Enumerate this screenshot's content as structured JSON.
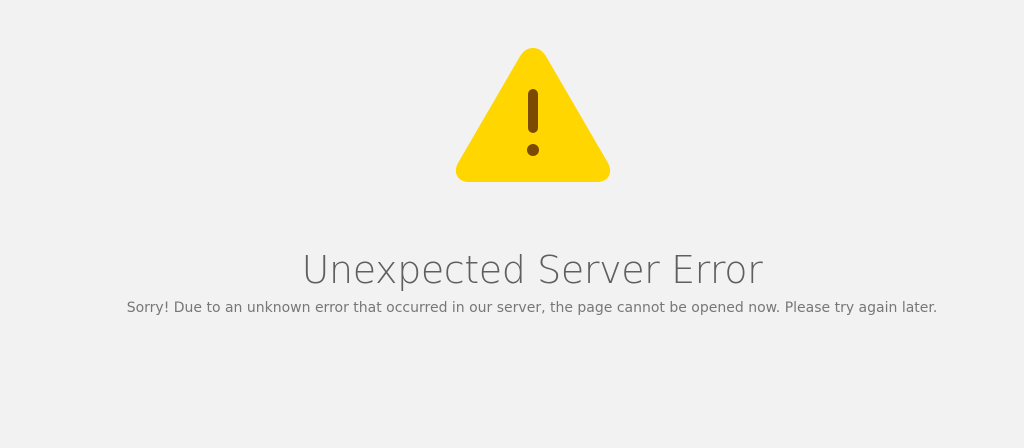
{
  "error_page": {
    "icon": "warning-triangle-icon",
    "title": "Unexpected Server Error",
    "message": "Sorry! Due to an unknown error that occurred in our server, the page cannot be opened now. Please try again later."
  },
  "colors": {
    "background": "#f2f2f2",
    "icon_fill": "#ffd600",
    "icon_mark": "#7a4b00",
    "title_text": "#5f5f5f",
    "message_text": "#777777"
  }
}
